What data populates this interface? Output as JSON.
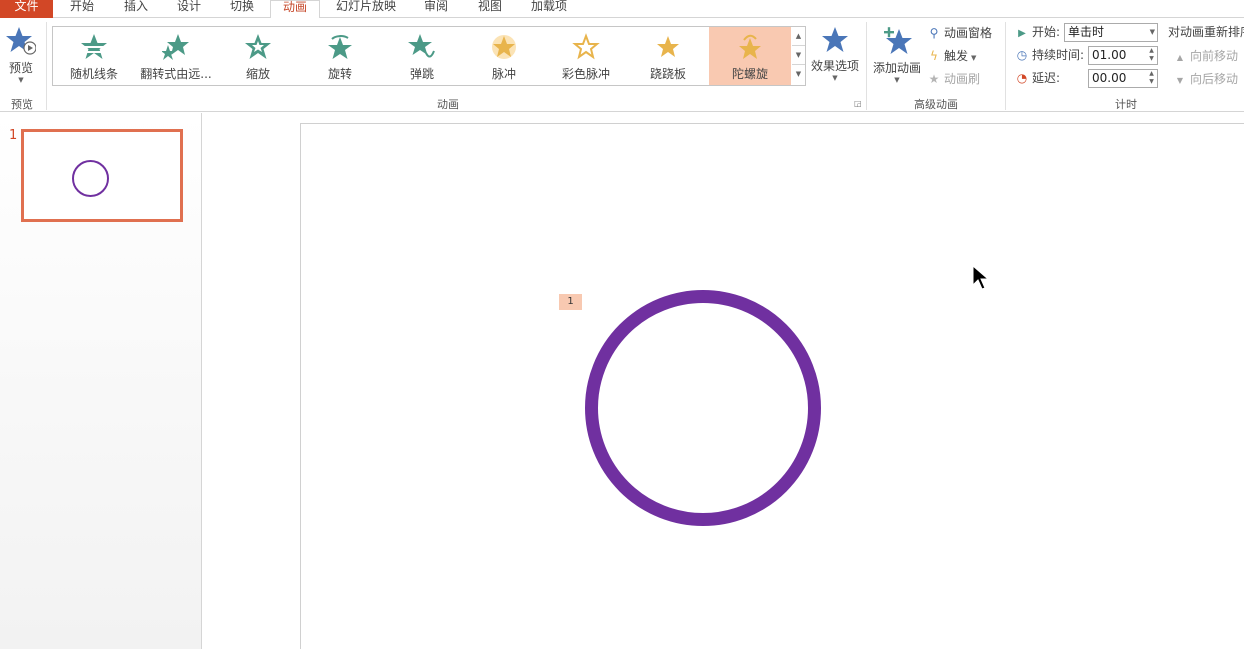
{
  "tabs": [
    "文件",
    "开始",
    "插入",
    "设计",
    "切换",
    "动画",
    "幻灯片放映",
    "审阅",
    "视图",
    "加载项"
  ],
  "active_tab": "动画",
  "ribbon": {
    "preview": {
      "label": "预览",
      "group": "预览"
    },
    "gallery": {
      "group": "动画",
      "items": [
        {
          "label": "随机线条",
          "icon": "random-bars-star-icon"
        },
        {
          "label": "翻转式由远...",
          "icon": "flip-star-icon"
        },
        {
          "label": "缩放",
          "icon": "zoom-star-icon"
        },
        {
          "label": "旋转",
          "icon": "spin-star-icon"
        },
        {
          "label": "弹跳",
          "icon": "bounce-star-icon"
        },
        {
          "label": "脉冲",
          "icon": "pulse-star-icon"
        },
        {
          "label": "彩色脉冲",
          "icon": "color-pulse-star-icon"
        },
        {
          "label": "跷跷板",
          "icon": "teeter-star-icon"
        },
        {
          "label": "陀螺旋",
          "icon": "spin-top-star-icon"
        }
      ],
      "selected": "陀螺旋"
    },
    "effect_options": "效果选项",
    "advanced": {
      "group": "高级动画",
      "add_animation": "添加动画",
      "animation_pane": "动画窗格",
      "trigger": "触发",
      "animation_painter": "动画刷"
    },
    "timing": {
      "group": "计时",
      "start_label": "开始:",
      "start_value": "单击时",
      "duration_label": "持续时间:",
      "duration_value": "01.00",
      "delay_label": "延迟:",
      "delay_value": "00.00"
    },
    "reorder": {
      "title": "对动画重新排序",
      "move_earlier": "向前移动",
      "move_later": "向后移动"
    }
  },
  "slides": [
    {
      "number": "1"
    }
  ],
  "slide": {
    "animation_tag": "1"
  },
  "colors": {
    "accent": "#d24726",
    "shape": "#7030a0",
    "selection": "#f9c9b1",
    "star_blue": "#4a76b8",
    "star_green": "#4c9a87",
    "star_gold": "#e8b44c"
  }
}
